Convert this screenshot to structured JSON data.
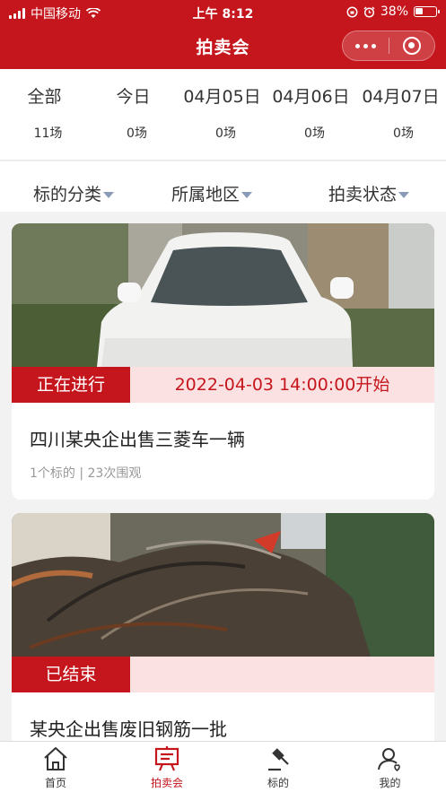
{
  "status_bar": {
    "carrier": "中国移动",
    "time": "上午 8:12",
    "battery": "38%",
    "battery_level": 0.38
  },
  "nav": {
    "title": "拍卖会"
  },
  "dates": [
    {
      "label": "全部",
      "count": "11场",
      "active": true
    },
    {
      "label": "今日",
      "count": "0场",
      "active": false
    },
    {
      "label": "04月05日",
      "count": "0场",
      "active": false
    },
    {
      "label": "04月06日",
      "count": "0场",
      "active": false
    },
    {
      "label": "04月07日",
      "count": "0场",
      "active": false
    }
  ],
  "filters": {
    "category": "标的分类",
    "region": "所属地区",
    "status": "拍卖状态"
  },
  "auctions": [
    {
      "status": "正在进行",
      "start_time": "2022-04-03 14:00:00开始",
      "title": "四川某央企出售三菱车一辆",
      "meta": "1个标的 | 23次围观"
    },
    {
      "status": "已结束",
      "start_time": "",
      "title": "某央企出售废旧钢筋一批",
      "meta": ""
    }
  ],
  "tabbar": [
    {
      "label": "首页",
      "icon": "home-icon",
      "active": false
    },
    {
      "label": "拍卖会",
      "icon": "auction-list-icon",
      "active": true
    },
    {
      "label": "标的",
      "icon": "gavel-icon",
      "active": false
    },
    {
      "label": "我的",
      "icon": "user-icon",
      "active": false
    }
  ],
  "colors": {
    "brand": "#c4161c",
    "status_bg": "#fce1e3"
  }
}
